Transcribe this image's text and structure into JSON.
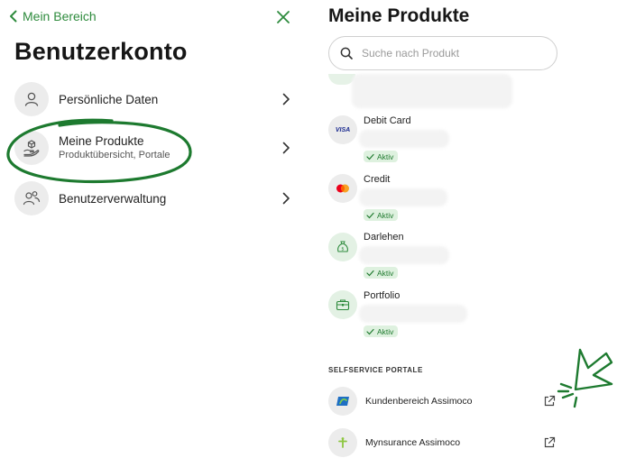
{
  "left": {
    "back_label": "Mein Bereich",
    "title": "Benutzerkonto",
    "items": [
      {
        "label": "Persönliche Daten",
        "sub": ""
      },
      {
        "label": "Meine Produkte",
        "sub": "Produktübersicht, Portale"
      },
      {
        "label": "Benutzerverwaltung",
        "sub": ""
      }
    ]
  },
  "right": {
    "title": "Meine Produkte",
    "search_placeholder": "Suche nach Produkt",
    "products": [
      {
        "name": "Debit Card",
        "icon_text": "VISA",
        "badge": "Aktiv"
      },
      {
        "name": "Credit",
        "badge": "Aktiv"
      },
      {
        "name": "Darlehen",
        "badge": "Aktiv"
      },
      {
        "name": "Portfolio",
        "badge": "Aktiv"
      }
    ],
    "section_title": "SELFSERVICE PORTALE",
    "portals": [
      {
        "name": "Kundenbereich Assimoco"
      },
      {
        "name": "Mynsurance Assimoco"
      }
    ]
  },
  "colors": {
    "accent_green": "#2e8b3d",
    "annotation_green": "#1d7a2f",
    "badge_bg": "#def1df"
  }
}
